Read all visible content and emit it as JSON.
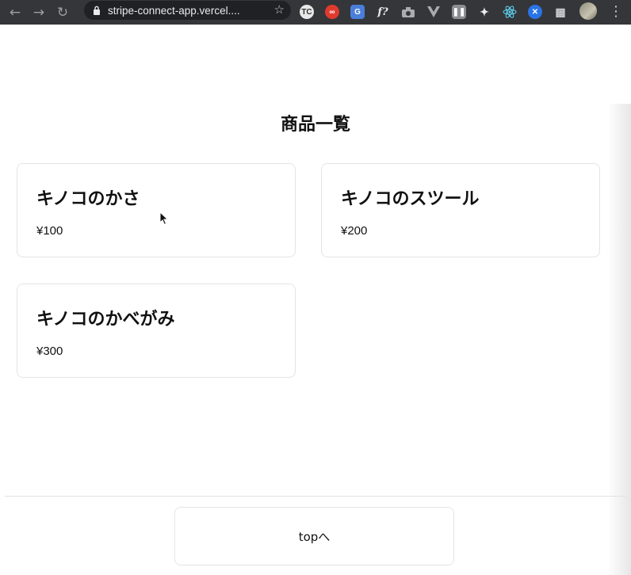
{
  "browser": {
    "url": "stripe-connect-app.vercel....",
    "back_icon": "arrow-left-icon",
    "forward_icon": "arrow-right-icon",
    "reload_icon": "reload-icon",
    "extensions": [
      {
        "name": "tc-extension-icon",
        "label": "TC",
        "color": "#e8e8e8"
      },
      {
        "name": "adobe-extension-icon",
        "label": "",
        "color": "#e03a2f"
      },
      {
        "name": "translate-extension-icon",
        "label": "G",
        "color": "#4a7fd9"
      },
      {
        "name": "font-extension-icon",
        "label": "f?",
        "color": "#35363a"
      },
      {
        "name": "camera-extension-icon",
        "label": "",
        "color": "#8a8d91"
      },
      {
        "name": "vue-extension-icon",
        "label": "",
        "color": "#8a8d91"
      },
      {
        "name": "pause-extension-icon",
        "label": "",
        "color": "#8a8d91"
      },
      {
        "name": "broom-extension-icon",
        "label": "",
        "color": "#35363a"
      },
      {
        "name": "react-extension-icon",
        "label": "",
        "color": "#35363a"
      },
      {
        "name": "blue-extension-icon",
        "label": "",
        "color": "#2a74e6"
      },
      {
        "name": "puzzle-extensions-icon",
        "label": "",
        "color": "#35363a"
      }
    ]
  },
  "page": {
    "title": "商品一覧",
    "products": [
      {
        "name": "キノコのかさ",
        "price": "¥100"
      },
      {
        "name": "キノコのスツール",
        "price": "¥200"
      },
      {
        "name": "キノコのかべがみ",
        "price": "¥300"
      }
    ],
    "top_button_label": "topへ"
  }
}
